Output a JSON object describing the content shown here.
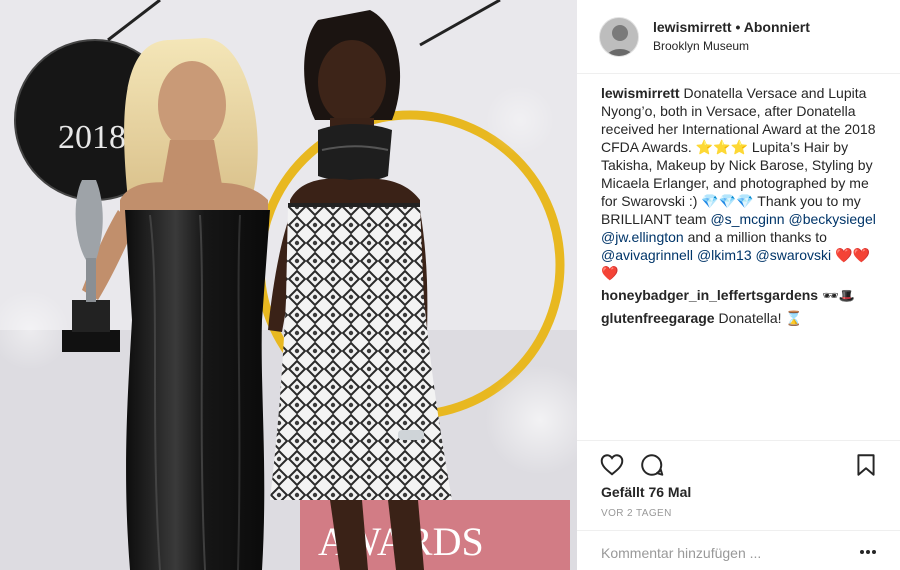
{
  "header": {
    "username": "lewismirrett",
    "separator": "•",
    "follow_status": "Abonniert",
    "location": "Brooklyn Museum"
  },
  "photo": {
    "year_text": "2018",
    "awards_text": "AWARDS"
  },
  "caption": {
    "username": "lewismirrett",
    "text_1": "Donatella Versace and Lupita Nyong’o, both in Versace, after Donatella received her International Award at the 2018 CFDA Awards. ",
    "stars": "⭐⭐⭐",
    "text_2": " Lupita’s Hair by Takisha, Makeup by Nick Barose, Styling by Micaela Erlanger, and photographed by me for Swarovski :) ",
    "diamonds": "💎💎💎",
    "text_3": " Thank you to my BRILLIANT team ",
    "mention_1": "@s_mcginn",
    "mention_2": "@beckysiegel",
    "mention_3": "@jw.ellington",
    "text_4": " and a million thanks to ",
    "mention_4": "@avivagrinnell",
    "mention_5": "@lkim13",
    "mention_6": "@swarovski",
    "hearts": "❤️❤️❤️"
  },
  "comments": [
    {
      "username": "honeybadger_in_leffertsgardens",
      "text": "🕶🎩"
    },
    {
      "username": "glutenfreegarage",
      "text": "Donatella! ⌛"
    }
  ],
  "actions": {
    "icons": [
      "heart-icon",
      "comment-icon",
      "bookmark-icon"
    ]
  },
  "likes": "Gefällt 76 Mal",
  "timestamp": "VOR 2 TAGEN",
  "add_comment": {
    "placeholder": "Kommentar hinzufügen ..."
  },
  "colors": {
    "text": "#262626",
    "mention": "#003569",
    "muted": "#999999",
    "divider": "#efefef",
    "gold_ring": "#e8b820"
  }
}
